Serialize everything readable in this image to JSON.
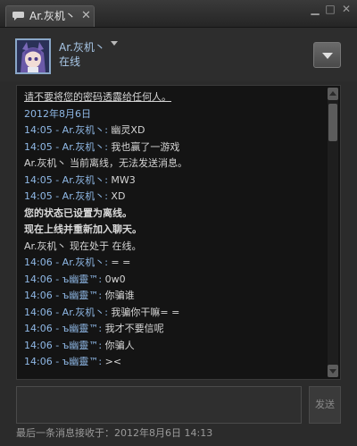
{
  "tab": {
    "label": "Ar.灰机丶",
    "close": "✕"
  },
  "window": {
    "minimize": "▁",
    "maximize": "□",
    "close": "✕"
  },
  "friend": {
    "name": "Ar.灰机丶",
    "status": "在线"
  },
  "chat": {
    "warning": "请不要将您的密码透露给任何人。",
    "date": "2012年8月6日",
    "lines": [
      {
        "text": "14:05 - Ar.灰机丶: ",
        "msg": "幽灵XD"
      },
      {
        "text": "14:05 - Ar.灰机丶: ",
        "msg": "我也赢了一游戏"
      },
      {
        "text": "",
        "msg": "Ar.灰机丶 当前离线，无法发送消息。"
      },
      {
        "text": "14:05 - Ar.灰机丶: ",
        "msg": "MW3"
      },
      {
        "text": "14:05 - Ar.灰机丶: ",
        "msg": "XD"
      }
    ],
    "system": [
      "您的状态已设置为离线。",
      "现在上线并重新加入聊天。"
    ],
    "online_notice": "Ar.灰机丶 现在处于 在线。",
    "lines2": [
      {
        "text": "14:06 - Ar.灰机丶: ",
        "msg": "= ="
      },
      {
        "text": "14:06 - ъ幽靈™: ",
        "msg": "0w0"
      },
      {
        "text": "14:06 - ъ幽靈™: ",
        "msg": "你骗谁"
      },
      {
        "text": "14:06 - Ar.灰机丶: ",
        "msg": "我骗你干嘛= ="
      },
      {
        "text": "14:06 - ъ幽靈™: ",
        "msg": "我才不要信呢"
      },
      {
        "text": "14:06 - ъ幽靈™: ",
        "msg": "你骗人"
      },
      {
        "text": "14:06 - ъ幽靈™: ",
        "msg": "><"
      }
    ]
  },
  "input": {
    "value": "",
    "placeholder": ""
  },
  "send_label": "发送",
  "footer": "最后一条消息接收于：2012年8月6日 14:13",
  "colors": {
    "accent": "#8fb8e6",
    "background": "#2b2b2b",
    "log_bg": "#141414"
  }
}
